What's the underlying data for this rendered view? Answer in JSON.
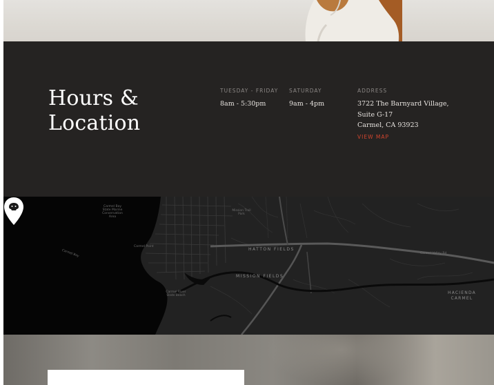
{
  "hours_section": {
    "title_line1": "Hours &",
    "title_line2": "Location",
    "columns": [
      {
        "heading": "Tuesday - Friday",
        "lines": [
          "8am - 5:30pm"
        ]
      },
      {
        "heading": "Saturday",
        "lines": [
          "9am - 4pm"
        ]
      },
      {
        "heading": "Address",
        "lines": [
          "3722 The Barnyard Village,",
          "Suite G-17",
          "Carmel, CA 93923"
        ]
      }
    ],
    "view_map_label": "View Map",
    "accent_color": "#d2452e",
    "background_color": "#252322"
  },
  "map": {
    "labels": {
      "hatton_fields": "Hatton Fields",
      "mission_fields": "Mission Fields",
      "hacienda_carmel_line1": "Hacienda",
      "hacienda_carmel_line2": "Carmel",
      "carmel_bay": "Carmel Bay State Marine Conservation Area",
      "carmel_point": "Carmel Point",
      "carmel_river": "Carmel River State Beach",
      "carmel_valley_road": "Carmel Valley Rd",
      "mission_trail": "Mission Trail Park",
      "carmel_bay_water": "Carmel Bay"
    },
    "marker_icon": "map-pin-icon",
    "theme": "dark"
  }
}
